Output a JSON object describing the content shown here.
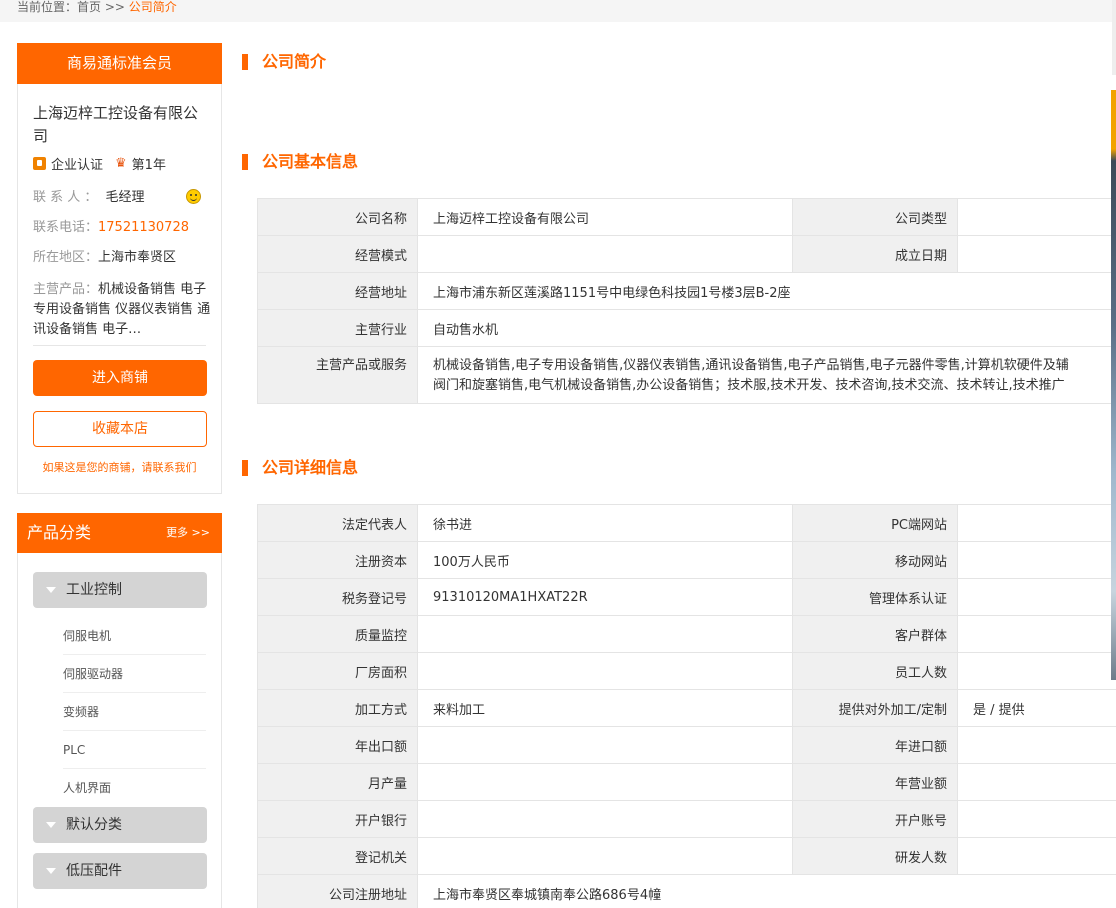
{
  "breadcrumb": {
    "prefix": "当前位置：",
    "home": "首页",
    "sep": " >> ",
    "current": "公司简介"
  },
  "sidebar": {
    "header": "商易通标准会员",
    "company_name": "上海迈梓工控设备有限公司",
    "cert_label": "企业认证",
    "year_label": "第1年",
    "contact_label": "联 系 人 ：",
    "contact_value": "毛经理",
    "phone_label": "联系电话：",
    "phone_value": "17521130728",
    "region_label": "所在地区：",
    "region_value": "上海市奉贤区",
    "products_label": "主营产品：",
    "products_value": "机械设备销售 电子专用设备销售 仪器仪表销售 通讯设备销售 电子…",
    "enter_button": "进入商铺",
    "favorite_button": "收藏本店",
    "claim_text": "如果这是您的商铺，请联系我们"
  },
  "category": {
    "title": "产品分类",
    "more": "更多 >>",
    "groups": [
      {
        "label": "工业控制",
        "items": [
          "伺服电机",
          "伺服驱动器",
          "变频器",
          "PLC",
          "人机界面"
        ]
      },
      {
        "label": "默认分类"
      },
      {
        "label": "低压配件"
      }
    ]
  },
  "sections": {
    "intro_title": "公司简介",
    "basic_title": "公司基本信息",
    "detail_title": "公司详细信息"
  },
  "basic": {
    "company_name_k": "公司名称",
    "company_name_v": "上海迈梓工控设备有限公司",
    "company_type_k": "公司类型",
    "company_type_v": "",
    "biz_mode_k": "经营模式",
    "biz_mode_v": "",
    "founded_k": "成立日期",
    "founded_v": "",
    "address_k": "经营地址",
    "address_v": "上海市浦东新区莲溪路1151号中电绿色科技园1号楼3层B-2座",
    "industry_k": "主营行业",
    "industry_v": "自动售水机",
    "products_k": "主营产品或服务",
    "products_v1": "机械设备销售,电子专用设备销售,仪器仪表销售,通讯设备销售,电子产品销售,电子元器件零售,计算机软硬件及辅",
    "products_v2": "阀门和旋塞销售,电气机械设备销售,办公设备销售；技术服,技术开发、技术咨询,技术交流、技术转让,技术推广"
  },
  "detail": {
    "rows": [
      {
        "k1": "法定代表人",
        "v1": "徐书进",
        "k2": "PC端网站",
        "v2": ""
      },
      {
        "k1": "注册资本",
        "v1": "100万人民币",
        "k2": "移动网站",
        "v2": ""
      },
      {
        "k1": "税务登记号",
        "v1": "91310120MA1HXAT22R",
        "k2": "管理体系认证",
        "v2": ""
      },
      {
        "k1": "质量监控",
        "v1": "",
        "k2": "客户群体",
        "v2": ""
      },
      {
        "k1": "厂房面积",
        "v1": "",
        "k2": "员工人数",
        "v2": ""
      },
      {
        "k1": "加工方式",
        "v1": "来料加工",
        "k2": "提供对外加工/定制",
        "v2": "是 / 提供"
      },
      {
        "k1": "年出口额",
        "v1": "",
        "k2": "年进口额",
        "v2": ""
      },
      {
        "k1": "月产量",
        "v1": "",
        "k2": "年营业额",
        "v2": ""
      },
      {
        "k1": "开户银行",
        "v1": "",
        "k2": "开户账号",
        "v2": ""
      },
      {
        "k1": "登记机关",
        "v1": "",
        "k2": "研发人数",
        "v2": ""
      }
    ],
    "reg_addr_k": "公司注册地址",
    "reg_addr_v": "上海市奉贤区奉城镇南奉公路686号4幢"
  }
}
